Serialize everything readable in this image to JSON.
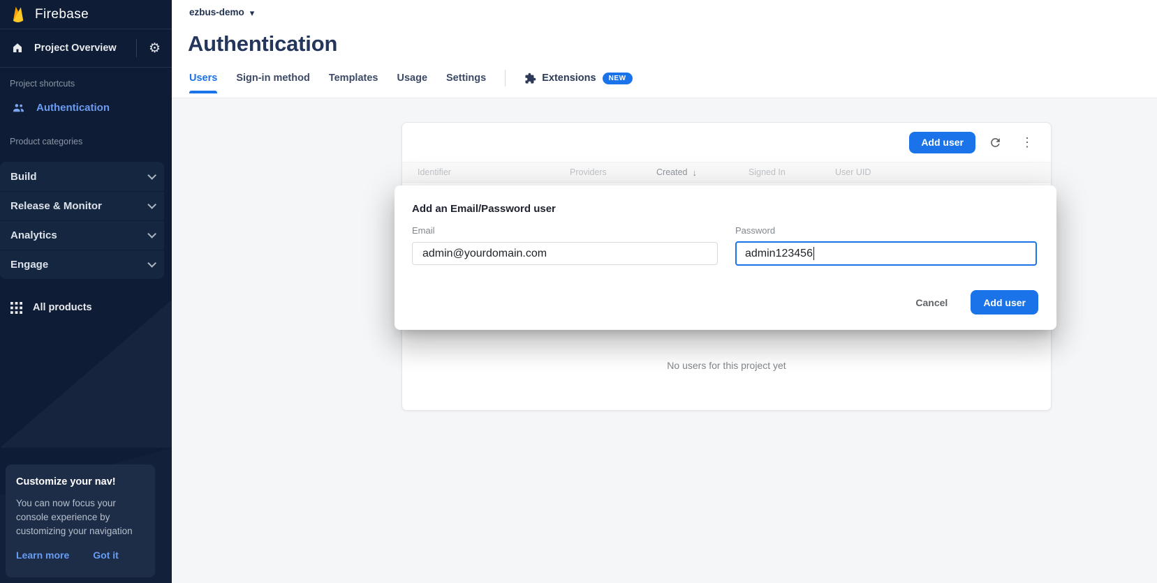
{
  "sidebar": {
    "brand": "Firebase",
    "project_overview_label": "Project Overview",
    "shortcuts_section_label": "Project shortcuts",
    "shortcut_auth_label": "Authentication",
    "categories_section_label": "Product categories",
    "categories": [
      {
        "label": "Build"
      },
      {
        "label": "Release & Monitor"
      },
      {
        "label": "Analytics"
      },
      {
        "label": "Engage"
      }
    ],
    "all_products_label": "All products",
    "promo": {
      "title": "Customize your nav!",
      "body": "You can now focus your console experience by customizing your navigation",
      "learn_more_label": "Learn more",
      "got_it_label": "Got it"
    }
  },
  "header": {
    "project_name": "ezbus-demo",
    "page_title": "Authentication",
    "tabs": [
      {
        "label": "Users",
        "active": true
      },
      {
        "label": "Sign-in method",
        "active": false
      },
      {
        "label": "Templates",
        "active": false
      },
      {
        "label": "Usage",
        "active": false
      },
      {
        "label": "Settings",
        "active": false
      }
    ],
    "extensions_tab": {
      "label": "Extensions",
      "badge": "NEW"
    }
  },
  "users_panel": {
    "add_user_button_label": "Add user",
    "columns": [
      "Identifier",
      "Providers",
      "Created",
      "Signed In",
      "User UID"
    ],
    "sorted_column": "Created",
    "empty_message": "No users for this project yet"
  },
  "dialog": {
    "title": "Add an Email/Password user",
    "email_label": "Email",
    "email_value": "admin@yourdomain.com",
    "password_label": "Password",
    "password_value": "admin123456",
    "cancel_label": "Cancel",
    "submit_label": "Add user"
  },
  "icons": {
    "gear_glyph": "⚙",
    "dropdown_arrow_glyph": "▾",
    "sort_desc_glyph": "↓",
    "more_vert_glyph": "⋮"
  },
  "colors": {
    "accent_blue": "#1a73e8",
    "sidebar_bg": "#0e1c36",
    "sidebar_panel_bg": "#152640",
    "link_blue": "#669df6",
    "title_navy": "#24365c"
  }
}
